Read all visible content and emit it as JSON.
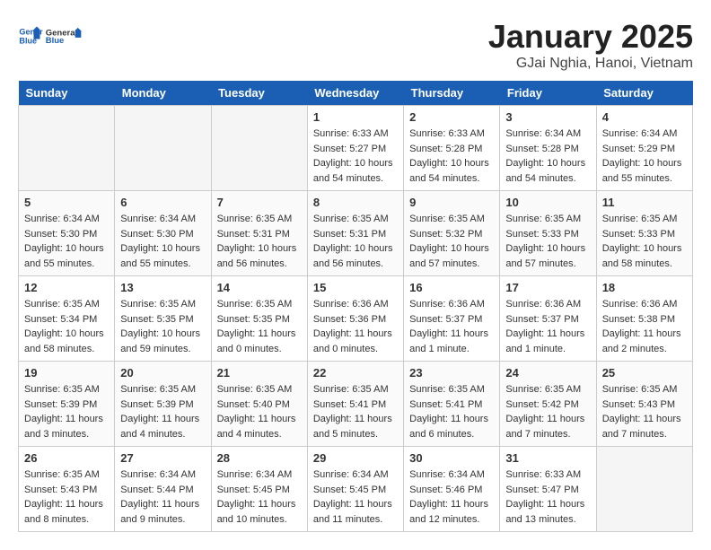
{
  "header": {
    "logo_line1": "General",
    "logo_line2": "Blue",
    "month_title": "January 2025",
    "location": "GJai Nghia, Hanoi, Vietnam"
  },
  "weekdays": [
    "Sunday",
    "Monday",
    "Tuesday",
    "Wednesday",
    "Thursday",
    "Friday",
    "Saturday"
  ],
  "weeks": [
    [
      {
        "day": "",
        "empty": true
      },
      {
        "day": "",
        "empty": true
      },
      {
        "day": "",
        "empty": true
      },
      {
        "day": "1",
        "sunrise": "Sunrise: 6:33 AM",
        "sunset": "Sunset: 5:27 PM",
        "daylight": "Daylight: 10 hours and 54 minutes."
      },
      {
        "day": "2",
        "sunrise": "Sunrise: 6:33 AM",
        "sunset": "Sunset: 5:28 PM",
        "daylight": "Daylight: 10 hours and 54 minutes."
      },
      {
        "day": "3",
        "sunrise": "Sunrise: 6:34 AM",
        "sunset": "Sunset: 5:28 PM",
        "daylight": "Daylight: 10 hours and 54 minutes."
      },
      {
        "day": "4",
        "sunrise": "Sunrise: 6:34 AM",
        "sunset": "Sunset: 5:29 PM",
        "daylight": "Daylight: 10 hours and 55 minutes."
      }
    ],
    [
      {
        "day": "5",
        "sunrise": "Sunrise: 6:34 AM",
        "sunset": "Sunset: 5:30 PM",
        "daylight": "Daylight: 10 hours and 55 minutes."
      },
      {
        "day": "6",
        "sunrise": "Sunrise: 6:34 AM",
        "sunset": "Sunset: 5:30 PM",
        "daylight": "Daylight: 10 hours and 55 minutes."
      },
      {
        "day": "7",
        "sunrise": "Sunrise: 6:35 AM",
        "sunset": "Sunset: 5:31 PM",
        "daylight": "Daylight: 10 hours and 56 minutes."
      },
      {
        "day": "8",
        "sunrise": "Sunrise: 6:35 AM",
        "sunset": "Sunset: 5:31 PM",
        "daylight": "Daylight: 10 hours and 56 minutes."
      },
      {
        "day": "9",
        "sunrise": "Sunrise: 6:35 AM",
        "sunset": "Sunset: 5:32 PM",
        "daylight": "Daylight: 10 hours and 57 minutes."
      },
      {
        "day": "10",
        "sunrise": "Sunrise: 6:35 AM",
        "sunset": "Sunset: 5:33 PM",
        "daylight": "Daylight: 10 hours and 57 minutes."
      },
      {
        "day": "11",
        "sunrise": "Sunrise: 6:35 AM",
        "sunset": "Sunset: 5:33 PM",
        "daylight": "Daylight: 10 hours and 58 minutes."
      }
    ],
    [
      {
        "day": "12",
        "sunrise": "Sunrise: 6:35 AM",
        "sunset": "Sunset: 5:34 PM",
        "daylight": "Daylight: 10 hours and 58 minutes."
      },
      {
        "day": "13",
        "sunrise": "Sunrise: 6:35 AM",
        "sunset": "Sunset: 5:35 PM",
        "daylight": "Daylight: 10 hours and 59 minutes."
      },
      {
        "day": "14",
        "sunrise": "Sunrise: 6:35 AM",
        "sunset": "Sunset: 5:35 PM",
        "daylight": "Daylight: 11 hours and 0 minutes."
      },
      {
        "day": "15",
        "sunrise": "Sunrise: 6:36 AM",
        "sunset": "Sunset: 5:36 PM",
        "daylight": "Daylight: 11 hours and 0 minutes."
      },
      {
        "day": "16",
        "sunrise": "Sunrise: 6:36 AM",
        "sunset": "Sunset: 5:37 PM",
        "daylight": "Daylight: 11 hours and 1 minute."
      },
      {
        "day": "17",
        "sunrise": "Sunrise: 6:36 AM",
        "sunset": "Sunset: 5:37 PM",
        "daylight": "Daylight: 11 hours and 1 minute."
      },
      {
        "day": "18",
        "sunrise": "Sunrise: 6:36 AM",
        "sunset": "Sunset: 5:38 PM",
        "daylight": "Daylight: 11 hours and 2 minutes."
      }
    ],
    [
      {
        "day": "19",
        "sunrise": "Sunrise: 6:35 AM",
        "sunset": "Sunset: 5:39 PM",
        "daylight": "Daylight: 11 hours and 3 minutes."
      },
      {
        "day": "20",
        "sunrise": "Sunrise: 6:35 AM",
        "sunset": "Sunset: 5:39 PM",
        "daylight": "Daylight: 11 hours and 4 minutes."
      },
      {
        "day": "21",
        "sunrise": "Sunrise: 6:35 AM",
        "sunset": "Sunset: 5:40 PM",
        "daylight": "Daylight: 11 hours and 4 minutes."
      },
      {
        "day": "22",
        "sunrise": "Sunrise: 6:35 AM",
        "sunset": "Sunset: 5:41 PM",
        "daylight": "Daylight: 11 hours and 5 minutes."
      },
      {
        "day": "23",
        "sunrise": "Sunrise: 6:35 AM",
        "sunset": "Sunset: 5:41 PM",
        "daylight": "Daylight: 11 hours and 6 minutes."
      },
      {
        "day": "24",
        "sunrise": "Sunrise: 6:35 AM",
        "sunset": "Sunset: 5:42 PM",
        "daylight": "Daylight: 11 hours and 7 minutes."
      },
      {
        "day": "25",
        "sunrise": "Sunrise: 6:35 AM",
        "sunset": "Sunset: 5:43 PM",
        "daylight": "Daylight: 11 hours and 7 minutes."
      }
    ],
    [
      {
        "day": "26",
        "sunrise": "Sunrise: 6:35 AM",
        "sunset": "Sunset: 5:43 PM",
        "daylight": "Daylight: 11 hours and 8 minutes."
      },
      {
        "day": "27",
        "sunrise": "Sunrise: 6:34 AM",
        "sunset": "Sunset: 5:44 PM",
        "daylight": "Daylight: 11 hours and 9 minutes."
      },
      {
        "day": "28",
        "sunrise": "Sunrise: 6:34 AM",
        "sunset": "Sunset: 5:45 PM",
        "daylight": "Daylight: 11 hours and 10 minutes."
      },
      {
        "day": "29",
        "sunrise": "Sunrise: 6:34 AM",
        "sunset": "Sunset: 5:45 PM",
        "daylight": "Daylight: 11 hours and 11 minutes."
      },
      {
        "day": "30",
        "sunrise": "Sunrise: 6:34 AM",
        "sunset": "Sunset: 5:46 PM",
        "daylight": "Daylight: 11 hours and 12 minutes."
      },
      {
        "day": "31",
        "sunrise": "Sunrise: 6:33 AM",
        "sunset": "Sunset: 5:47 PM",
        "daylight": "Daylight: 11 hours and 13 minutes."
      },
      {
        "day": "",
        "empty": true
      }
    ]
  ]
}
